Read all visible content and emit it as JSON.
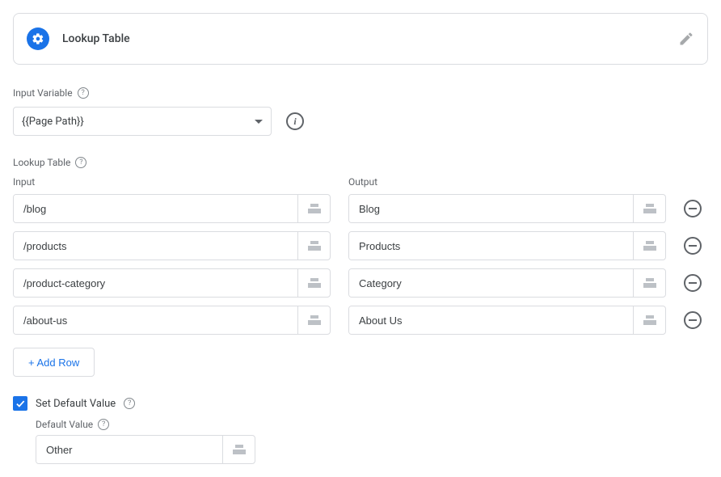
{
  "card": {
    "title": "Lookup Table"
  },
  "labels": {
    "input_variable": "Input Variable",
    "lookup_table": "Lookup Table",
    "col_input": "Input",
    "col_output": "Output",
    "add_row": "+ Add Row",
    "set_default": "Set Default Value",
    "default_value": "Default Value"
  },
  "input_variable": {
    "value": "{{Page Path}}"
  },
  "rows": [
    {
      "input": "/blog",
      "output": "Blog"
    },
    {
      "input": "/products",
      "output": "Products"
    },
    {
      "input": "/product-category",
      "output": "Category"
    },
    {
      "input": "/about-us",
      "output": "About Us"
    }
  ],
  "default_value": "Other",
  "set_default_checked": true
}
